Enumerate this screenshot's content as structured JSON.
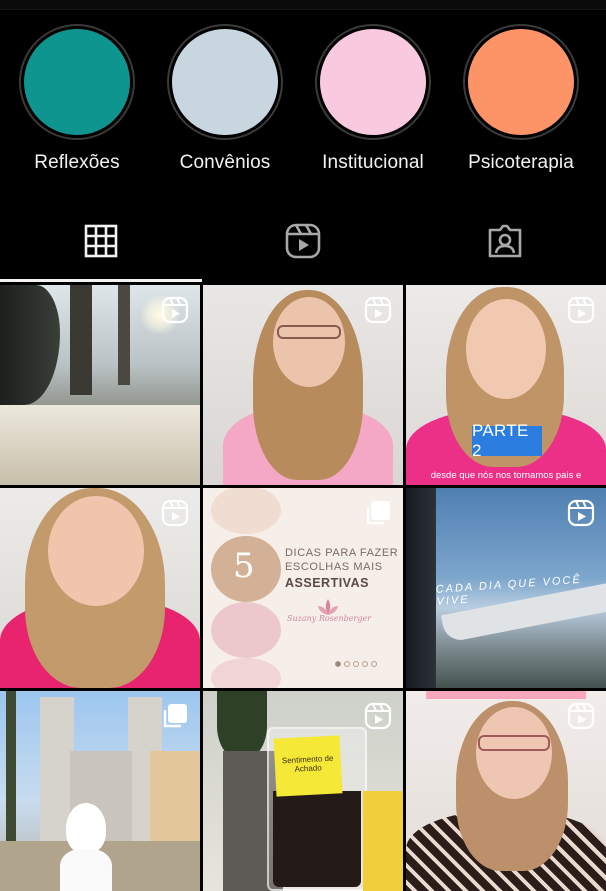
{
  "highlights": [
    {
      "label": "Reflexões",
      "color": "#0f958f"
    },
    {
      "label": "Convênios",
      "color": "#c8d6e0"
    },
    {
      "label": "Institucional",
      "color": "#f9c9e0"
    },
    {
      "label": "Psicoterapia",
      "color": "#fd9468"
    }
  ],
  "tabs": [
    {
      "name": "posts-grid",
      "icon": "grid-icon",
      "active": true
    },
    {
      "name": "reels",
      "icon": "reels-icon",
      "active": false
    },
    {
      "name": "tagged",
      "icon": "tagged-person-icon",
      "active": false
    }
  ],
  "posts": [
    {
      "type": "reel",
      "scene": "snowy-forest-sunlight"
    },
    {
      "type": "reel",
      "scene": "woman-glasses-pink-shirt"
    },
    {
      "type": "reel",
      "scene": "woman-speaking-pink-shirt",
      "badge_text": "PARTE 2",
      "caption": "desde que nós nos tornamos pais e"
    },
    {
      "type": "reel",
      "scene": "woman-smiling-pink-shirt"
    },
    {
      "type": "carousel",
      "scene": "tips-card",
      "number": "5",
      "line1": "DICAS PARA FAZER",
      "line2": "ESCOLHAS MAIS",
      "line3": "ASSERTIVAS",
      "brand": "Suzany Rosenberger"
    },
    {
      "type": "reel",
      "scene": "airplane-window",
      "overlay_text": "CADA DIA QUE VOCÊ VIVE"
    },
    {
      "type": "carousel",
      "scene": "church-with-mascot"
    },
    {
      "type": "reel",
      "scene": "coffee-mug-sticky-note",
      "note_text": "Sentimento de Achado"
    },
    {
      "type": "reel",
      "scene": "woman-glasses-patterned-top"
    }
  ],
  "colors": {
    "background": "#000000",
    "text": "#f2f2f2",
    "active_tab_line": "#f2f2f2"
  }
}
